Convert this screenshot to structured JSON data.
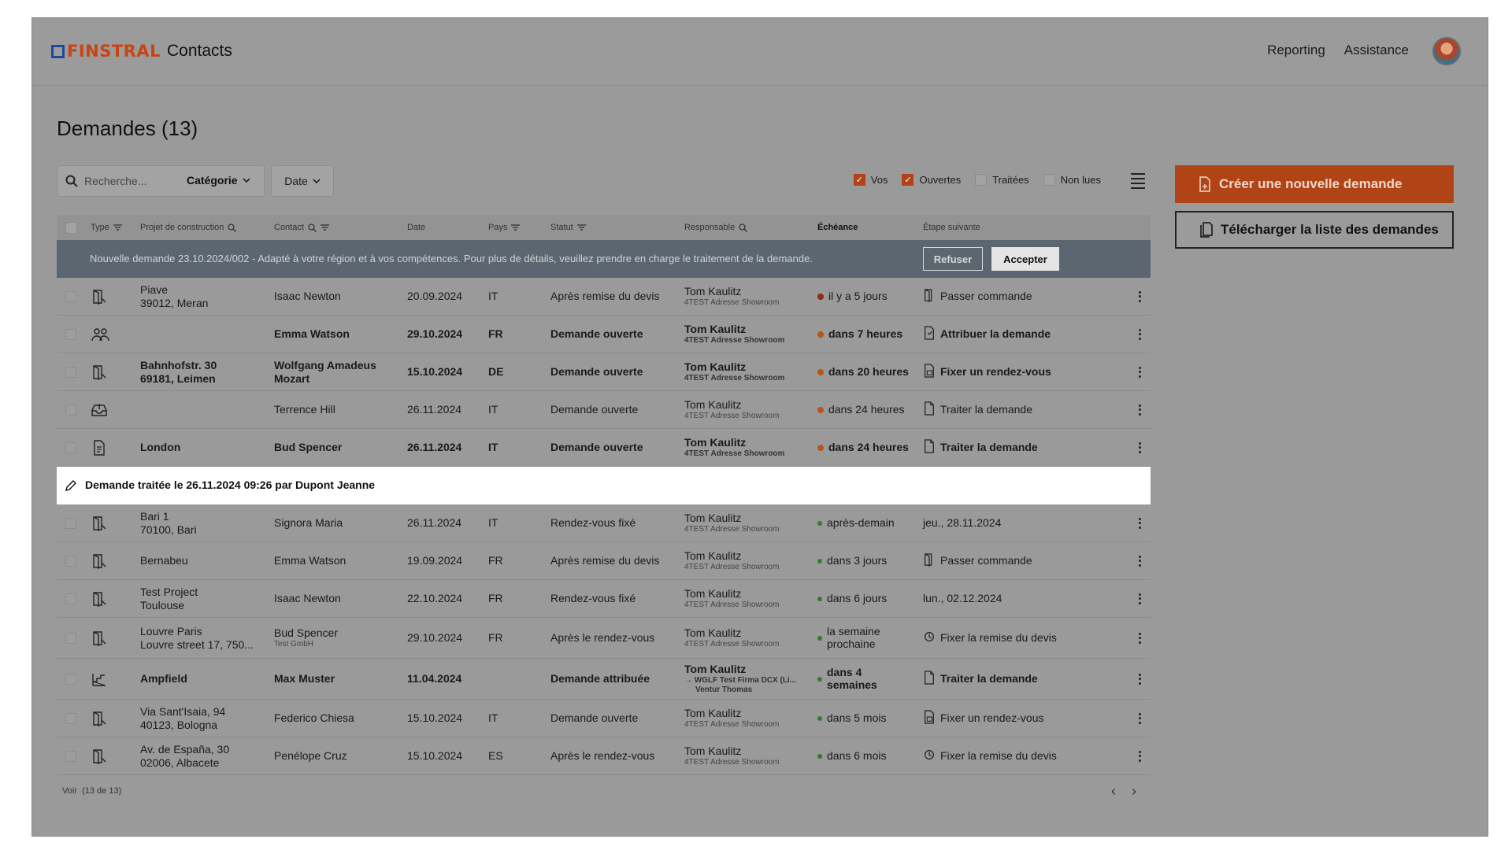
{
  "header": {
    "logo": "FINSTRAL",
    "app_name": "Contacts",
    "nav": [
      "Reporting",
      "Assistance"
    ]
  },
  "page": {
    "title": "Demandes (13)"
  },
  "toolbar": {
    "search_placeholder": "Recherche...",
    "category_label": "Catégorie",
    "date_label": "Date",
    "filters": [
      {
        "label": "Vos",
        "checked": true
      },
      {
        "label": "Ouvertes",
        "checked": true
      },
      {
        "label": "Traitées",
        "checked": false
      },
      {
        "label": "Non lues",
        "checked": false
      }
    ]
  },
  "actions": {
    "create": "Créer une nouvelle demande",
    "download": "Télécharger la liste des demandes"
  },
  "table": {
    "headers": {
      "type": "Type",
      "project": "Projet de construction",
      "contact": "Contact",
      "date": "Date",
      "country": "Pays",
      "status": "Statut",
      "responsible": "Responsable",
      "deadline": "Échéance",
      "next_step": "Étape suivante"
    },
    "banner": {
      "text": "Nouvelle demande 23.10.2024/002 - Adapté à votre région et à vos compétences. Pour plus de détails, veuillez prendre en charge le traitement de la demande.",
      "refuse": "Refuser",
      "accept": "Accepter"
    },
    "rows_open": [
      {
        "icon": "door-icon",
        "bold": false,
        "project1": "Piave",
        "project2": "39012, Meran",
        "contact": "Isaac Newton",
        "contact2": "",
        "date": "20.09.2024",
        "country": "IT",
        "status": "Après remise du devis",
        "resp": "Tom Kaulitz",
        "resp2": "4TEST Adresse Showroom",
        "resp3": "",
        "dot": "red",
        "deadline": "il y a 5 jours",
        "step_icon": "order-icon",
        "step": "Passer commande"
      },
      {
        "icon": "group-icon",
        "bold": true,
        "project1": "",
        "project2": "",
        "contact": "Emma Watson",
        "contact2": "",
        "date": "29.10.2024",
        "country": "FR",
        "status": "Demande ouverte",
        "resp": "Tom Kaulitz",
        "resp2": "4TEST Adresse Showroom",
        "resp3": "",
        "dot": "orange",
        "deadline": "dans 7 heures",
        "step_icon": "assign-icon",
        "step": "Attribuer la demande"
      },
      {
        "icon": "door-icon",
        "bold": true,
        "project1": "Bahnhofstr. 30",
        "project2": "69181, Leimen",
        "contact": "Wolfgang Amadeus",
        "contact2": "Mozart",
        "date": "15.10.2024",
        "country": "DE",
        "status": "Demande ouverte",
        "resp": "Tom Kaulitz",
        "resp2": "4TEST Adresse Showroom",
        "resp3": "",
        "dot": "orange",
        "deadline": "dans 20 heures",
        "step_icon": "calendar-doc-icon",
        "step": "Fixer un rendez-vous"
      },
      {
        "icon": "inbox-icon",
        "bold": false,
        "project1": "",
        "project2": "",
        "contact": "Terrence Hill",
        "contact2": "",
        "date": "26.11.2024",
        "country": "IT",
        "status": "Demande ouverte",
        "resp": "Tom Kaulitz",
        "resp2": "4TEST Adresse Showroom",
        "resp3": "",
        "dot": "orange",
        "deadline": "dans 24 heures",
        "step_icon": "process-icon",
        "step": "Traiter la demande"
      },
      {
        "icon": "document-icon",
        "bold": true,
        "project1": "London",
        "project2": "",
        "contact": "Bud Spencer",
        "contact2": "",
        "date": "26.11.2024",
        "country": "IT",
        "status": "Demande ouverte",
        "resp": "Tom Kaulitz",
        "resp2": "4TEST Adresse Showroom",
        "resp3": "",
        "dot": "orange",
        "deadline": "dans 24 heures",
        "step_icon": "process-icon",
        "step": "Traiter la demande"
      }
    ],
    "treated_banner": "Demande traitée le 26.11.2024 09:26 par Dupont Jeanne",
    "rows_rest": [
      {
        "icon": "door-icon",
        "bold": false,
        "project1": "Bari 1",
        "project2": "70100, Bari",
        "contact": "Signora Maria",
        "contact2": "",
        "date": "26.11.2024",
        "country": "IT",
        "status": "Rendez-vous fixé",
        "resp": "Tom Kaulitz",
        "resp2": "4TEST Adresse Showroom",
        "resp3": "",
        "dot": "green",
        "deadline": "après-demain",
        "deadline2": "",
        "step_icon": "",
        "step": "jeu., 28.11.2024"
      },
      {
        "icon": "door-icon",
        "bold": false,
        "project1": "Bernabeu",
        "project2": "",
        "contact": "Emma Watson",
        "contact2": "",
        "date": "19.09.2024",
        "country": "FR",
        "status": "Après remise du devis",
        "resp": "Tom Kaulitz",
        "resp2": "4TEST Adresse Showroom",
        "resp3": "",
        "dot": "green",
        "deadline": "dans 3 jours",
        "deadline2": "",
        "step_icon": "order-icon",
        "step": "Passer commande"
      },
      {
        "icon": "door-icon",
        "bold": false,
        "project1": "Test Project",
        "project2": "Toulouse",
        "contact": "Isaac Newton",
        "contact2": "",
        "date": "22.10.2024",
        "country": "FR",
        "status": "Rendez-vous fixé",
        "resp": "Tom Kaulitz",
        "resp2": "4TEST Adresse Showroom",
        "resp3": "",
        "dot": "green",
        "deadline": "dans 6 jours",
        "deadline2": "",
        "step_icon": "",
        "step": "lun., 02.12.2024"
      },
      {
        "icon": "door-icon",
        "bold": false,
        "project1": "Louvre Paris",
        "project2": "Louvre street 17, 750...",
        "contact": "Bud Spencer",
        "contact2": "Test GmbH",
        "date": "29.10.2024",
        "country": "FR",
        "status": "Après le rendez-vous",
        "resp": "Tom Kaulitz",
        "resp2": "4TEST Adresse Showroom",
        "resp3": "",
        "dot": "green",
        "deadline": "la semaine",
        "deadline2": "prochaine",
        "step_icon": "quote-icon",
        "step": "Fixer la remise du devis"
      },
      {
        "icon": "stairs-icon",
        "bold": true,
        "project1": "Ampfield",
        "project2": "",
        "contact": "Max Muster",
        "contact2": "",
        "date": "11.04.2024",
        "country": "",
        "status": "Demande attribuée",
        "resp": "Tom Kaulitz",
        "resp2": "→ WGLF Test Firma DCX (Li...",
        "resp3": "Ventur Thomas",
        "dot": "green",
        "deadline": "dans 4",
        "deadline2": "semaines",
        "step_icon": "process-icon",
        "step": "Traiter la demande"
      },
      {
        "icon": "door-icon",
        "bold": false,
        "project1": "Via Sant'Isaia, 94",
        "project2": "40123, Bologna",
        "contact": "Federico Chiesa",
        "contact2": "",
        "date": "15.10.2024",
        "country": "IT",
        "status": "Demande ouverte",
        "resp": "Tom Kaulitz",
        "resp2": "4TEST Adresse Showroom",
        "resp3": "",
        "dot": "green",
        "deadline": "dans 5 mois",
        "deadline2": "",
        "step_icon": "calendar-doc-icon",
        "step": "Fixer un rendez-vous"
      },
      {
        "icon": "door-icon",
        "bold": false,
        "project1": "Av. de España, 30",
        "project2": "02006, Albacete",
        "contact": "Penélope Cruz",
        "contact2": "",
        "date": "15.10.2024",
        "country": "ES",
        "status": "Après le rendez-vous",
        "resp": "Tom Kaulitz",
        "resp2": "4TEST Adresse Showroom",
        "resp3": "",
        "dot": "green",
        "deadline": "dans 6 mois",
        "deadline2": "",
        "step_icon": "quote-icon",
        "step": "Fixer la remise du devis"
      }
    ],
    "footer": {
      "label": "Voir",
      "count": "(13 de 13)"
    }
  }
}
